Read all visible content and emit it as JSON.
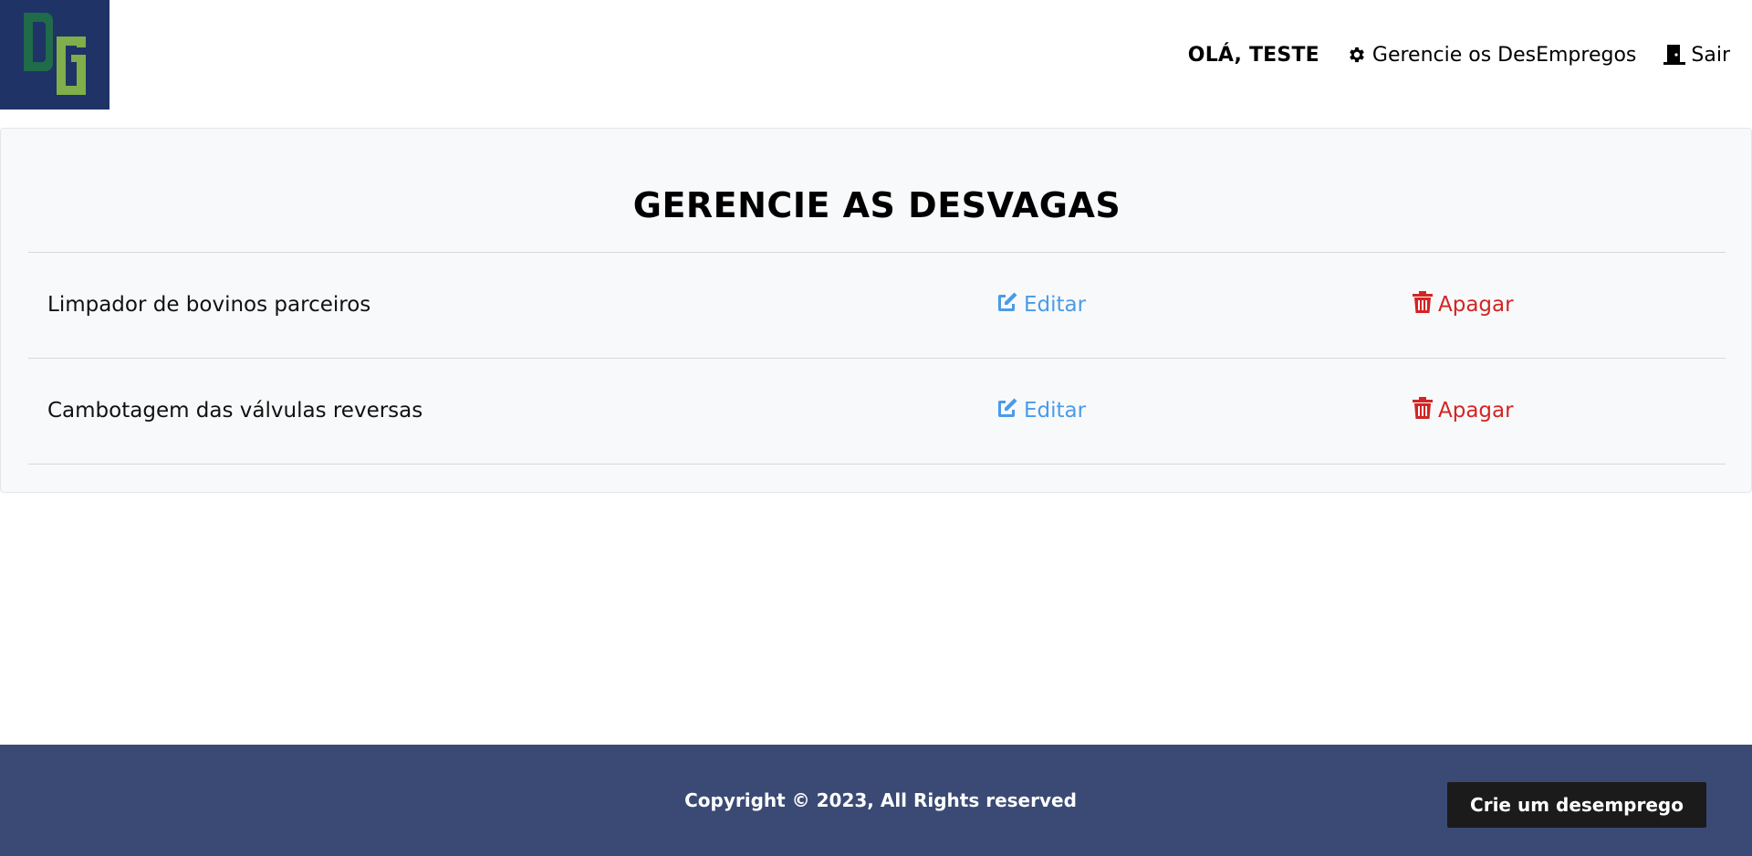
{
  "header": {
    "logo_text": "DG",
    "greeting": "OLÁ, TESTE",
    "nav": {
      "manage_label": "Gerencie os DesEmpregos",
      "manage_icon": "gear-icon",
      "logout_label": "Sair",
      "logout_icon": "door-icon"
    }
  },
  "main": {
    "title": "GERENCIE AS DESVAGAS",
    "rows": [
      {
        "name": "Limpador de bovinos parceiros",
        "edit_label": "Editar",
        "delete_label": "Apagar"
      },
      {
        "name": "Cambotagem das válvulas reversas",
        "edit_label": "Editar",
        "delete_label": "Apagar"
      }
    ]
  },
  "footer": {
    "copyright": "Copyright © 2023, All Rights reserved",
    "create_button": "Crie um desemprego"
  },
  "colors": {
    "logo_bg": "#1f3366",
    "logo_d": "#1f6b4a",
    "logo_g": "#7fae4a",
    "card_bg": "#f8f9fa",
    "edit": "#4a9be8",
    "delete": "#d32424",
    "footer_bg": "#3a4a74",
    "button_bg": "#1b1b1b"
  }
}
